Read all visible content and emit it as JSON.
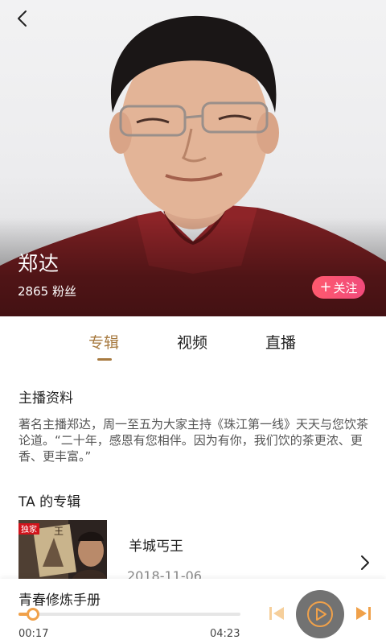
{
  "header": {
    "back_icon": "chevron-left-icon"
  },
  "host": {
    "name": "郑达",
    "fans": "2865 粉丝",
    "follow_label": "关注",
    "follow_plus": "+"
  },
  "tabs": [
    {
      "label": "专辑",
      "active": true
    },
    {
      "label": "视频",
      "active": false
    },
    {
      "label": "直播",
      "active": false
    }
  ],
  "profile": {
    "title": "主播资料",
    "bio": "著名主播郑达，周一至五为大家主持《珠江第一线》天天与您饮茶论道。“二十年，感恩有您相伴。因为有你，我们饮的茶更浓、更香、更丰富。”"
  },
  "albums": {
    "title": "TA 的专辑",
    "items": [
      {
        "title": "羊城丐王",
        "date": "2018-11-06",
        "cover_badge": "独家",
        "cover_text": "王"
      }
    ]
  },
  "player": {
    "track_title": "青春修炼手册",
    "current_time": "00:17",
    "total_time": "04:23",
    "progress": 0.065
  },
  "colors": {
    "accent": "#a77a40",
    "follow_gradient_start": "#ff5a6e",
    "follow_gradient_end": "#f04a7b",
    "progress": "#f0a14a",
    "play_button": "#727272"
  }
}
